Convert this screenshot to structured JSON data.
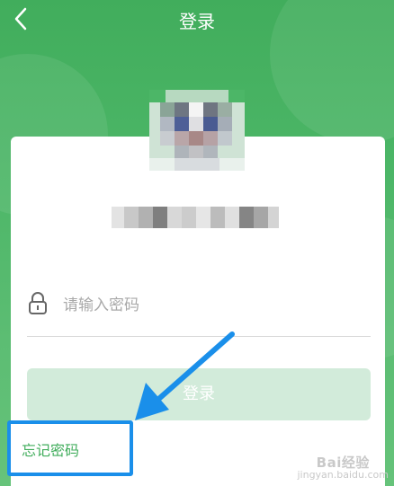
{
  "header": {
    "title": "登录",
    "back_icon": "chevron-left-icon"
  },
  "password": {
    "placeholder": "请输入密码",
    "icon": "lock-icon"
  },
  "login_button": {
    "label": "登录"
  },
  "forgot_password": {
    "label": "忘记密码"
  },
  "watermark": {
    "brand": "Bai经验",
    "url": "jingyan.baidu.com"
  },
  "colors": {
    "brand_green": "#41ad5c",
    "button_disabled": "#d2ebda",
    "highlight_blue": "#1a8fea"
  }
}
